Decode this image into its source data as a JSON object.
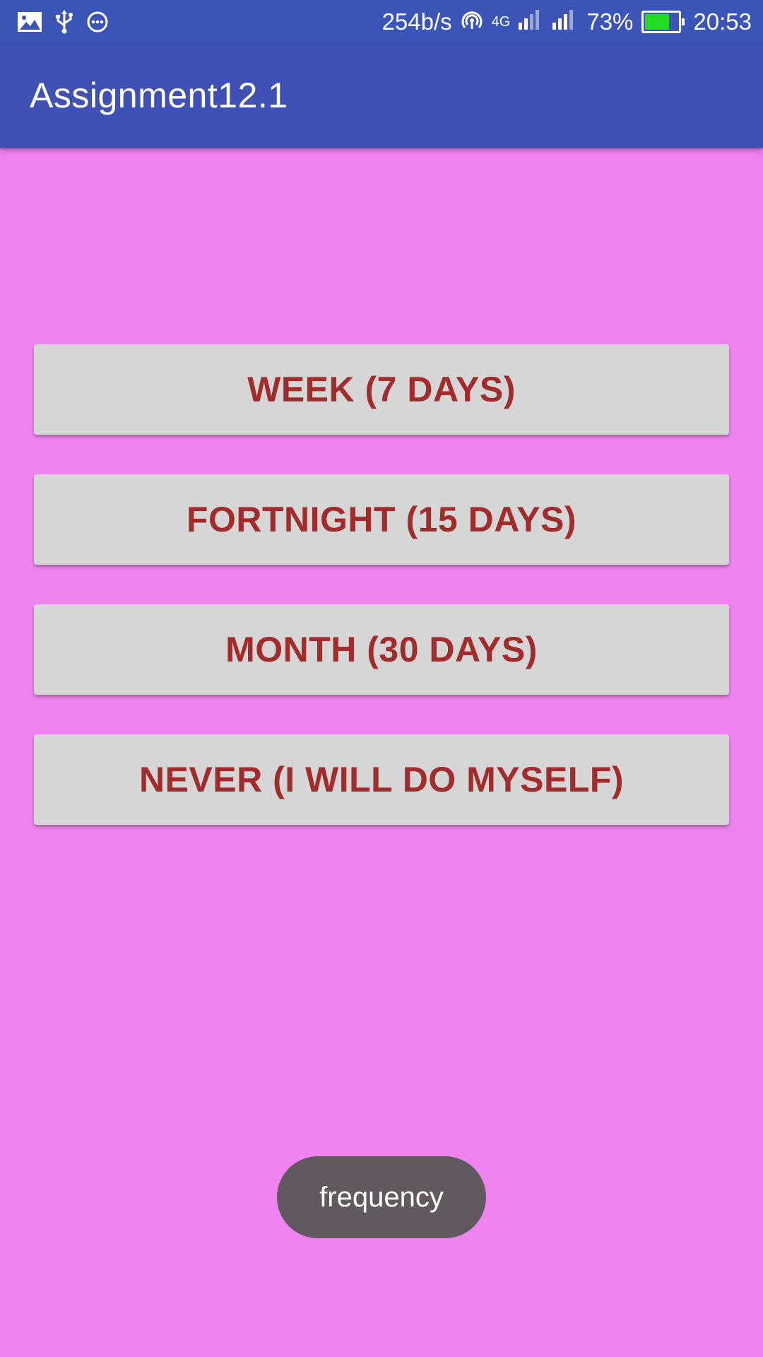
{
  "status_bar": {
    "left_icons": [
      "image-icon",
      "usb-icon",
      "more-circle-icon"
    ],
    "network_speed": "254b/s",
    "network_type": "4G",
    "battery_percent": "73%",
    "battery_level": 0.73,
    "time": "20:53"
  },
  "app_bar": {
    "title": "Assignment12.1",
    "color": "#3f51b5"
  },
  "options": [
    {
      "label": "WEEK (7 DAYS)"
    },
    {
      "label": "FORTNIGHT (15 DAYS)"
    },
    {
      "label": "MONTH (30 DAYS)"
    },
    {
      "label": "NEVER (I WILL DO MYSELF)"
    }
  ],
  "toast": {
    "message": "frequency"
  },
  "colors": {
    "background": "#ee82ee",
    "status_bar": "#3a54b8",
    "button_bg": "#d6d6d6",
    "button_text": "#a22b2b",
    "toast_bg": "#625960"
  }
}
